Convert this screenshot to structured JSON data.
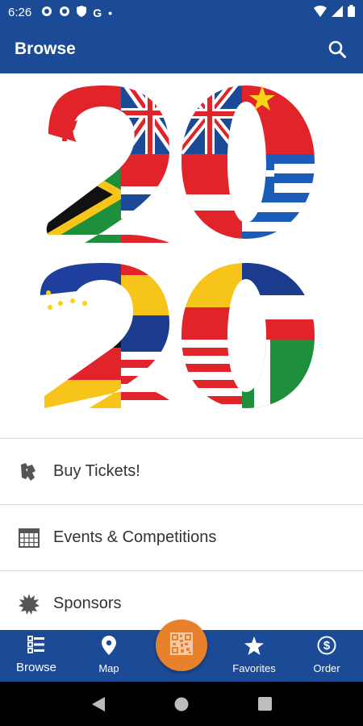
{
  "status_bar": {
    "time": "6:26",
    "icons": [
      "gear-icon",
      "gear-icon",
      "shield-icon",
      "google-icon",
      "dot-icon"
    ],
    "google_letter": "G",
    "dot": "•",
    "right_icons": [
      "wifi-icon",
      "signal-icon",
      "battery-icon"
    ]
  },
  "app_bar": {
    "title": "Browse",
    "action_icon": "search-icon"
  },
  "hero": {
    "graphic": "2020 flags logo"
  },
  "menu": {
    "items": [
      {
        "label": "Buy Tickets!",
        "icon": "tickets-icon"
      },
      {
        "label": "Events & Competitions",
        "icon": "calendar-grid-icon"
      },
      {
        "label": "Sponsors",
        "icon": "badge-burst-icon"
      }
    ]
  },
  "bottom_nav": {
    "items": [
      {
        "label": "Browse",
        "icon": "browse-list-icon"
      },
      {
        "label": "Map",
        "icon": "map-pin-icon"
      },
      {
        "label": "Favorites",
        "icon": "star-icon"
      },
      {
        "label": "Order",
        "icon": "dollar-circle-icon"
      }
    ],
    "fab_icon": "qr-code-icon"
  },
  "colors": {
    "primary": "#1b4a97",
    "accent": "#e8812b",
    "text": "#333333"
  }
}
